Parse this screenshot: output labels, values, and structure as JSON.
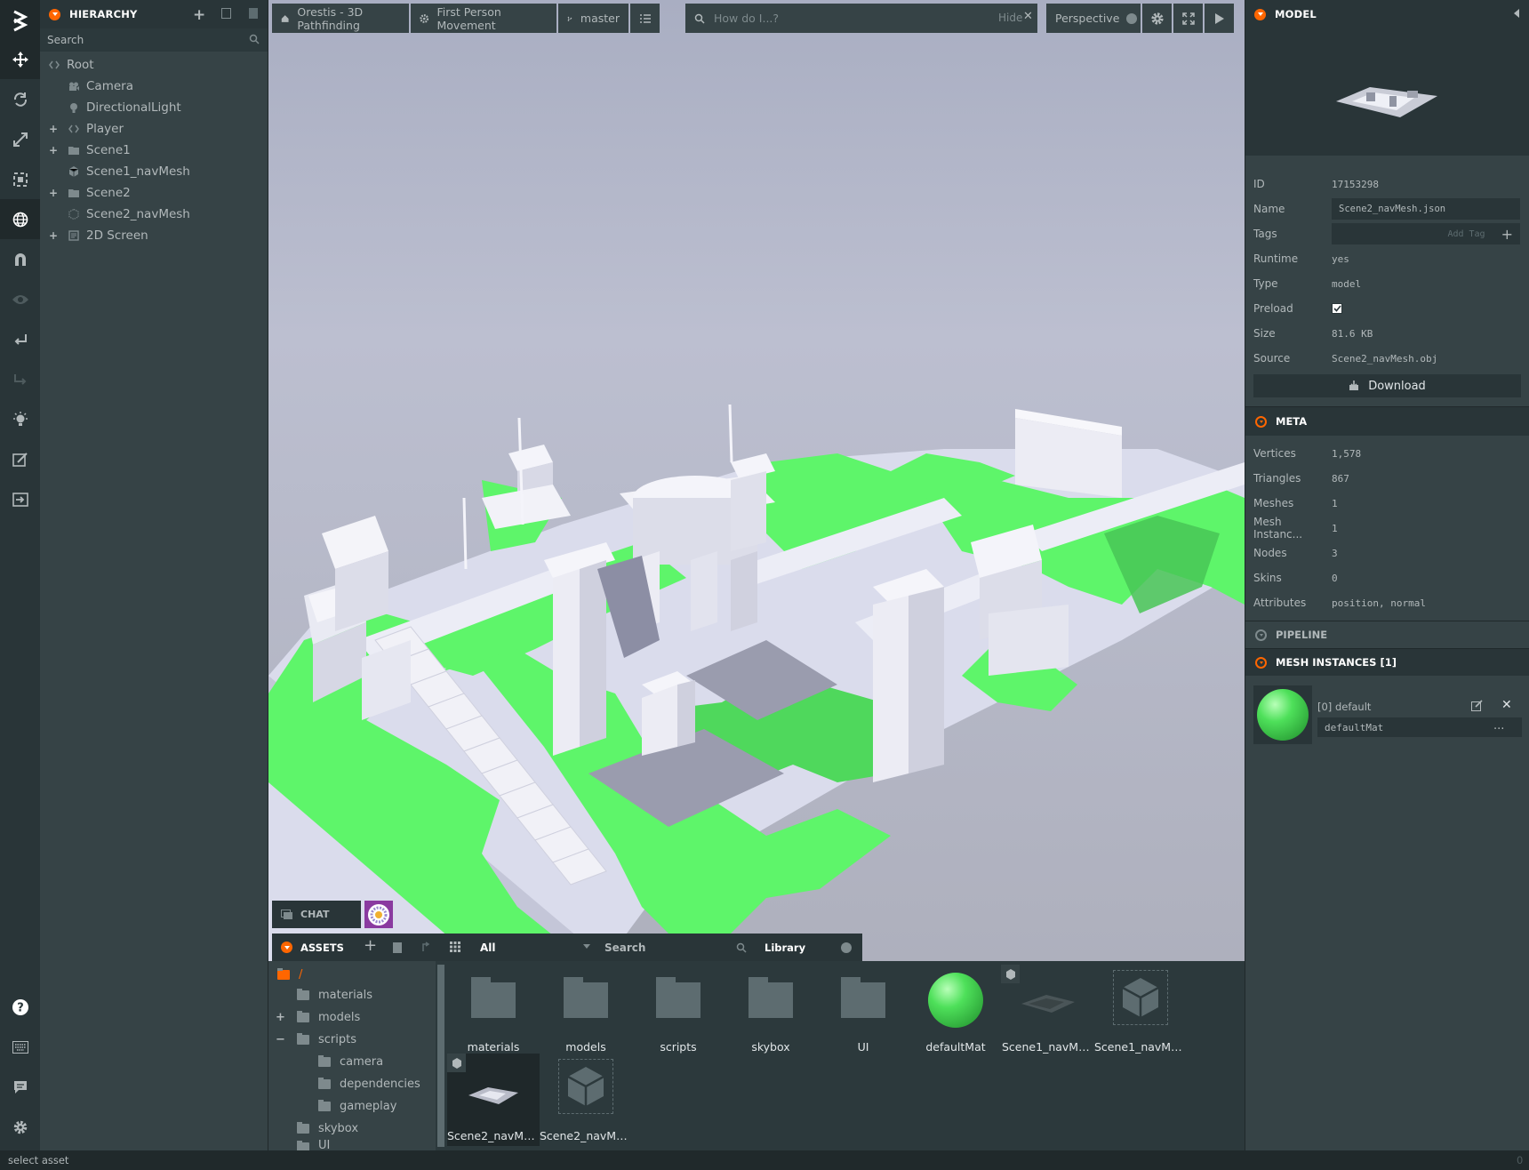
{
  "hierarchy": {
    "title": "HIERARCHY",
    "search_placeholder": "Search",
    "items": [
      {
        "label": "Root",
        "expander": ""
      },
      {
        "label": "Camera",
        "expander": ""
      },
      {
        "label": "DirectionalLight",
        "expander": ""
      },
      {
        "label": "Player",
        "expander": "+"
      },
      {
        "label": "Scene1",
        "expander": "+"
      },
      {
        "label": "Scene1_navMesh",
        "expander": ""
      },
      {
        "label": "Scene2",
        "expander": "+"
      },
      {
        "label": "Scene2_navMesh",
        "expander": ""
      },
      {
        "label": "2D Screen",
        "expander": "+"
      }
    ]
  },
  "viewport": {
    "project_label": "Orestis - 3D Pathfinding",
    "scene_label": "First Person Movement",
    "branch_label": "master",
    "search_placeholder": "How do I...?",
    "hide_label": "Hide",
    "camera_label": "Perspective",
    "chat_label": "CHAT"
  },
  "inspector": {
    "title": "MODEL",
    "properties": {
      "id_label": "ID",
      "id": "17153298",
      "name_label": "Name",
      "name": "Scene2_navMesh.json",
      "tags_label": "Tags",
      "tags_placeholder": "Add Tag",
      "runtime_label": "Runtime",
      "runtime": "yes",
      "type_label": "Type",
      "type": "model",
      "preload_label": "Preload",
      "size_label": "Size",
      "size": "81.6 KB",
      "source_label": "Source",
      "source": "Scene2_navMesh.obj"
    },
    "download_label": "Download",
    "meta": {
      "title": "META",
      "rows": [
        {
          "label": "Vertices",
          "value": "1,578"
        },
        {
          "label": "Triangles",
          "value": "867"
        },
        {
          "label": "Meshes",
          "value": "1"
        },
        {
          "label": "Mesh Instanc...",
          "value": "1"
        },
        {
          "label": "Nodes",
          "value": "3"
        },
        {
          "label": "Skins",
          "value": "0"
        },
        {
          "label": "Attributes",
          "value": "position, normal"
        }
      ]
    },
    "pipeline_title": "PIPELINE",
    "mesh_instances_title": "MESH INSTANCES [1]",
    "mesh_instance": {
      "label": "[0] default",
      "material": "defaultMat",
      "more": "..."
    }
  },
  "assets": {
    "title": "ASSETS",
    "filter": "All",
    "search_placeholder": "Search",
    "library_label": "Library",
    "tree": {
      "root": "/",
      "items": [
        "materials",
        "models",
        "scripts",
        "camera",
        "dependencies",
        "gameplay",
        "skybox",
        "UI"
      ],
      "expanders": [
        "",
        "+",
        "−",
        "",
        "",
        "",
        "",
        ""
      ]
    },
    "grid": [
      "materials",
      "models",
      "scripts",
      "skybox",
      "UI",
      "defaultMat",
      "Scene1_navMes...",
      "Scene1_navMes...",
      "Scene2_navMes...",
      "Scene2_navMes..."
    ]
  },
  "status": {
    "text": "select asset",
    "right": "0"
  },
  "colors": {
    "accent": "#ff6600",
    "navmesh_green": "#5ef56a",
    "panel": "#364346",
    "dark": "#293538"
  }
}
